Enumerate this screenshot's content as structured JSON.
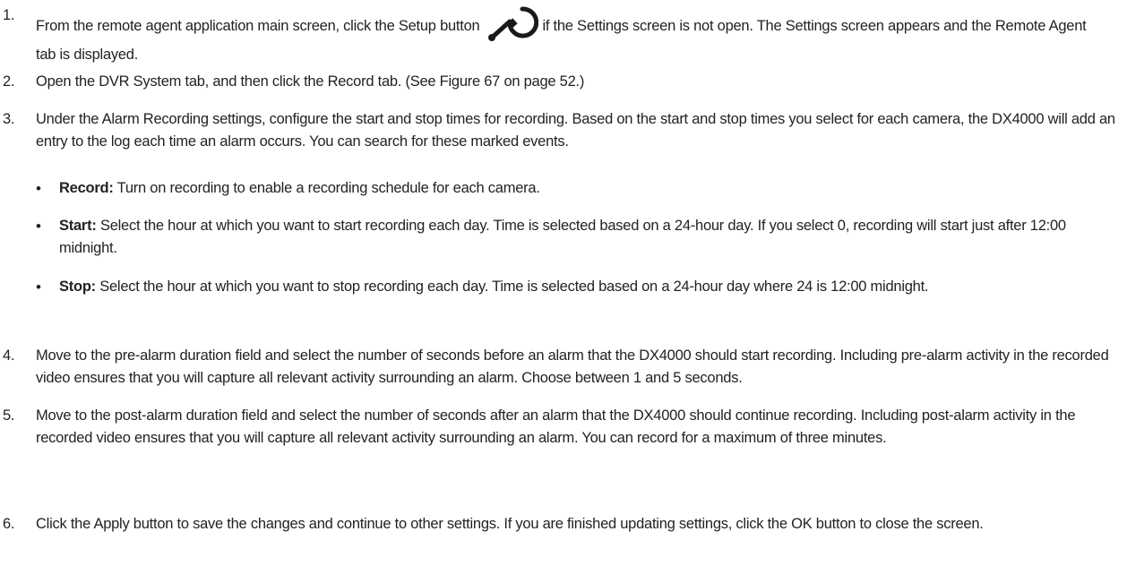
{
  "steps": [
    {
      "number": "1.",
      "text_before_icon": "From the remote agent application main screen, click the Setup button",
      "icon": "setup-wrench-icon",
      "text_after_icon": "if the Settings screen is not open. The Settings screen appears and the Remote Agent tab is displayed."
    },
    {
      "number": "2.",
      "text": "Open the DVR System tab, and then click the Record tab. (See Figure 67 on page 52.)"
    },
    {
      "number": "3.",
      "text": "Under the Alarm Recording settings, configure the start and stop times for recording. Based on the start and stop times you select for each camera, the DX4000 will add an entry to the log each time an alarm occurs. You can search for these marked events.",
      "bullets": [
        {
          "term": "Record:",
          "text": "Turn on recording to enable a recording schedule for each camera."
        },
        {
          "term": "Start:",
          "text": "Select the hour at which you want to start recording each day. Time is selected based on a 24-hour day. If you select 0, recording will start just after 12:00 midnight."
        },
        {
          "term": "Stop:",
          "text": "Select the hour at which you want to stop recording each day. Time is selected based on a 24-hour day where 24 is 12:00 midnight."
        }
      ]
    },
    {
      "number": "4.",
      "text": "Move to the pre-alarm duration field and select the number of seconds before an alarm that the DX4000 should start recording. Including pre-alarm activity in the recorded video ensures that you will capture all relevant activity surrounding an alarm. Choose between 1 and 5 seconds."
    },
    {
      "number": "5.",
      "text": "Move to the post-alarm duration field and select the number of seconds after an alarm that the DX4000 should continue recording. Including post-alarm activity in the recorded video ensures that you will capture all relevant activity surrounding an alarm. You can record for a maximum of three minutes."
    },
    {
      "number": "6.",
      "text": "Click the Apply button to save the changes and continue to other settings. If you are finished updating settings, click the OK button to close the screen."
    }
  ],
  "bullet_glyph": "•"
}
